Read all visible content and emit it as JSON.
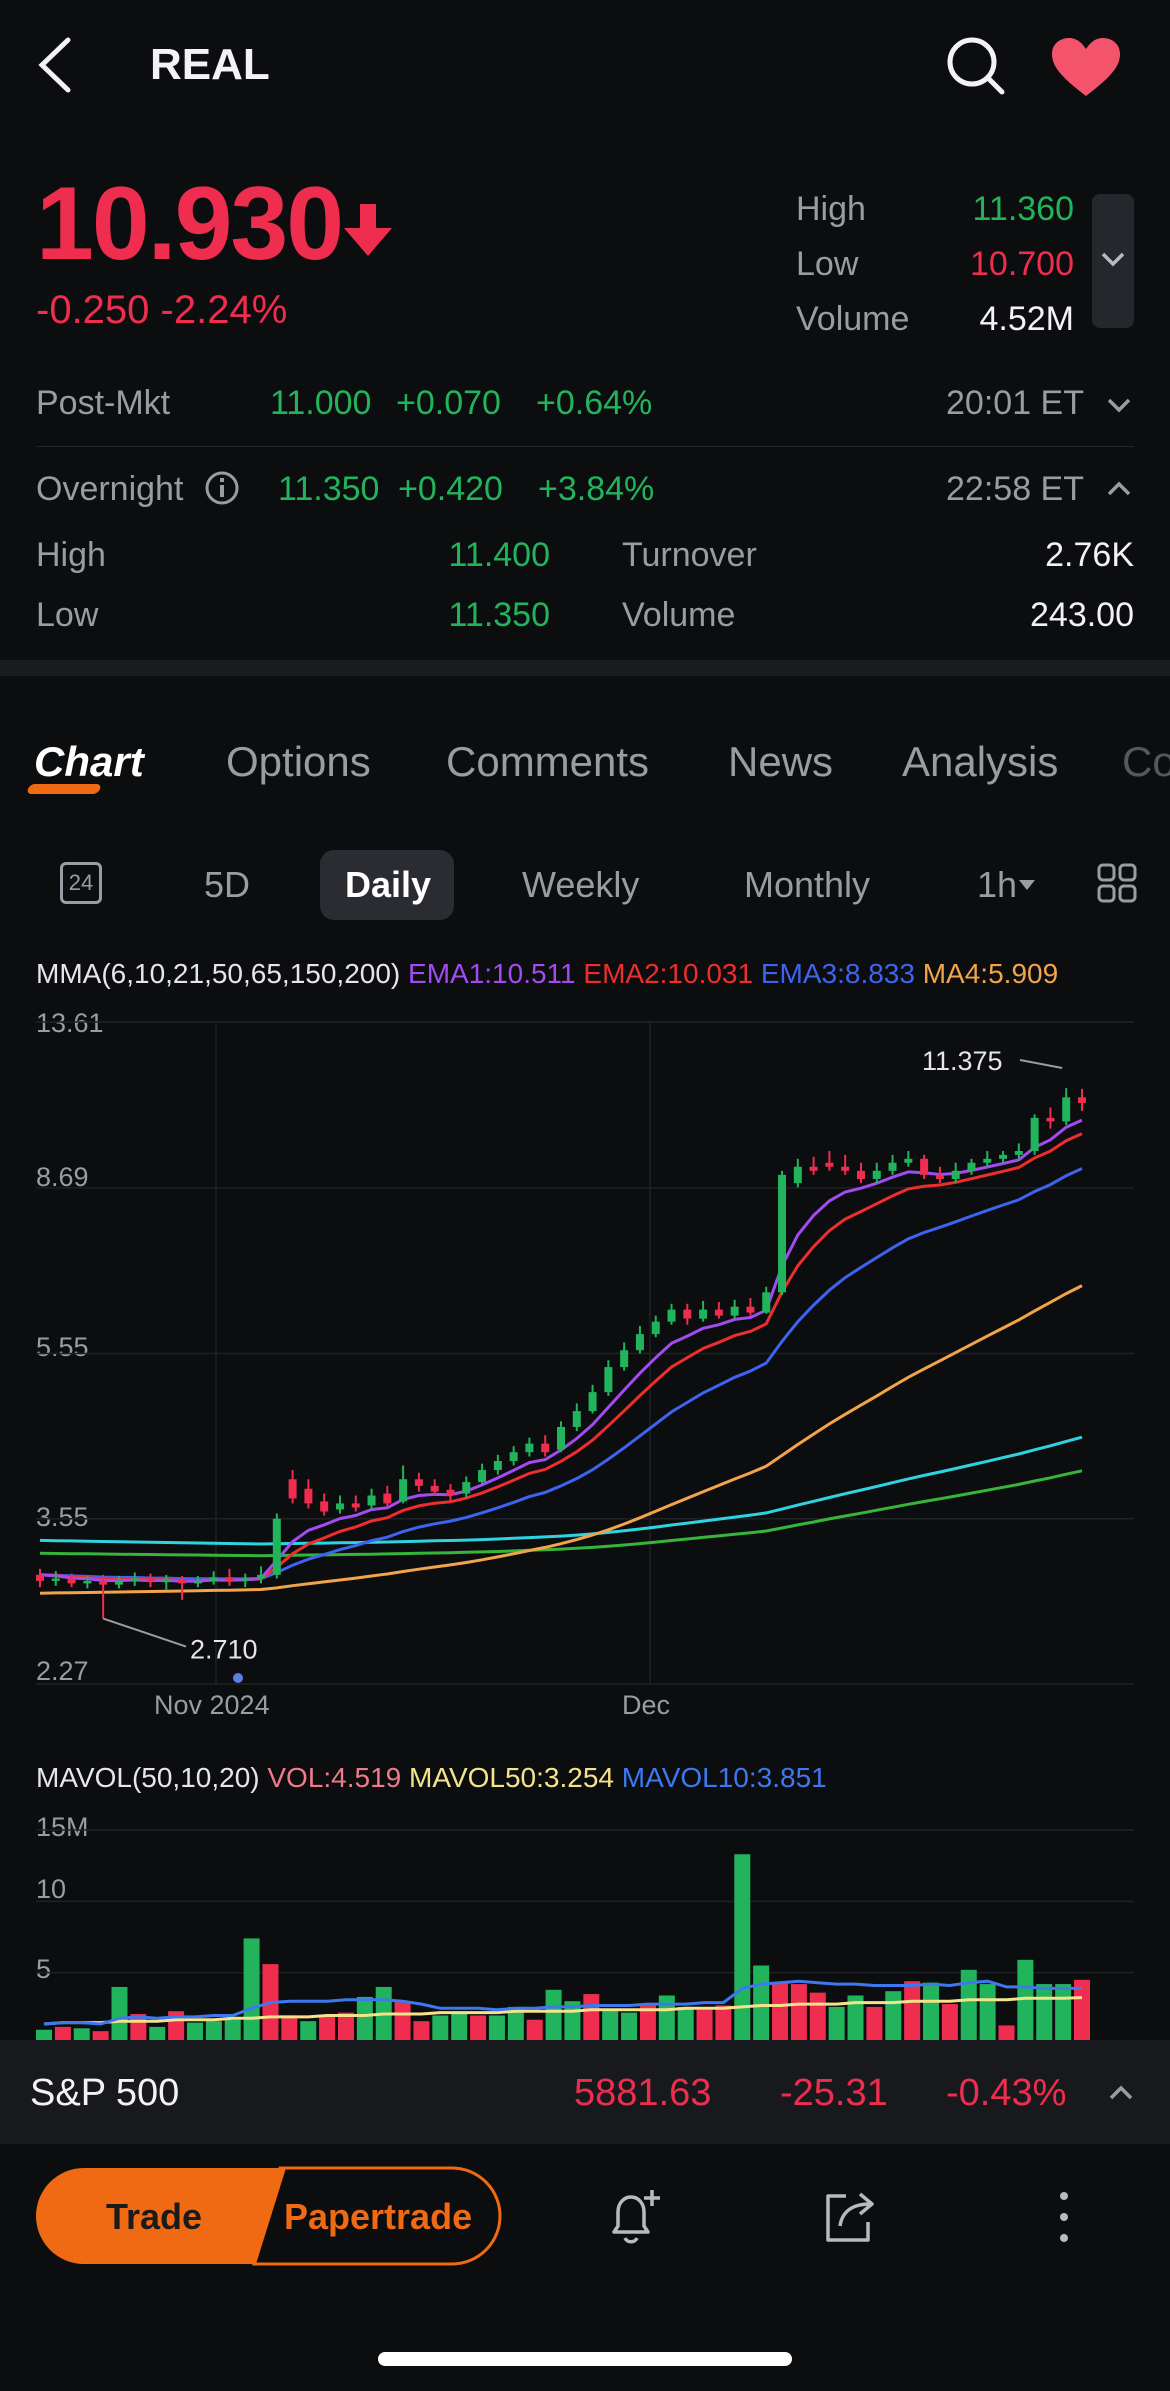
{
  "header": {
    "title": "REAL"
  },
  "quote": {
    "price": "10.930",
    "change": "-0.250",
    "change_pct": "-2.24%",
    "high_label": "High",
    "high": "11.360",
    "low_label": "Low",
    "low": "10.700",
    "volume_label": "Volume",
    "volume": "4.52M"
  },
  "post_market": {
    "label": "Post-Mkt",
    "price": "11.000",
    "change": "+0.070",
    "pct": "+0.64%",
    "time": "20:01 ET"
  },
  "overnight": {
    "label": "Overnight",
    "price": "11.350",
    "change": "+0.420",
    "pct": "+3.84%",
    "time": "22:58 ET",
    "high_label": "High",
    "high": "11.400",
    "low_label": "Low",
    "low": "11.350",
    "turnover_label": "Turnover",
    "turnover": "2.76K",
    "volume_label": "Volume",
    "volume": "243.00"
  },
  "tabs": [
    "Chart",
    "Options",
    "Comments",
    "News",
    "Analysis",
    "Co"
  ],
  "periods": {
    "badge": "24",
    "items": [
      "5D",
      "Daily",
      "Weekly",
      "Monthly",
      "1h"
    ]
  },
  "legend": {
    "mma": "MMA(6,10,21,50,65,150,200)",
    "ema1": "EMA1:10.511",
    "ema2": "EMA2:10.031",
    "ema3": "EMA3:8.833",
    "ma4": "MA4:5.909"
  },
  "vol_legend": {
    "mavol": "MAVOL(50,10,20)",
    "vol": "VOL:4.519",
    "mavol50": "MAVOL50:3.254",
    "mavol10": "MAVOL10:3.851"
  },
  "colors": {
    "up": "#22b45c",
    "down": "#ee2d4f",
    "ema1": "#a24bf0",
    "ema2": "#ee2d2d",
    "ema3": "#3d64f0",
    "ma4": "#f2a44a",
    "ma5": "#2fd3e0",
    "ma6": "#36b53a",
    "mavol50": "#f5e38a",
    "mavol10": "#3d78f0",
    "accent": "#ef6a12"
  },
  "chart_data": [
    {
      "type": "candlestick",
      "y_ticks": [
        "13.61",
        "8.69",
        "5.55",
        "3.55",
        "2.27"
      ],
      "x_ticks": [
        "Nov 2024",
        "Dec"
      ],
      "annotations": {
        "high": "11.375",
        "low": "2.710"
      },
      "candles": [
        [
          3.05,
          3.0,
          3.1,
          2.95
        ],
        [
          3.0,
          3.02,
          3.08,
          2.96
        ],
        [
          3.02,
          2.98,
          3.06,
          2.95
        ],
        [
          2.98,
          3.0,
          3.04,
          2.94
        ],
        [
          3.0,
          2.97,
          3.05,
          2.71
        ],
        [
          2.97,
          3.0,
          3.04,
          2.94
        ],
        [
          3.0,
          3.02,
          3.07,
          2.96
        ],
        [
          3.02,
          2.99,
          3.06,
          2.95
        ],
        [
          2.99,
          3.01,
          3.05,
          2.93
        ],
        [
          3.01,
          2.98,
          3.04,
          2.85
        ],
        [
          2.98,
          3.0,
          3.04,
          2.95
        ],
        [
          3.0,
          3.03,
          3.08,
          2.97
        ],
        [
          3.03,
          3.0,
          3.1,
          2.96
        ],
        [
          3.0,
          3.02,
          3.06,
          2.95
        ],
        [
          3.02,
          3.05,
          3.12,
          2.98
        ],
        [
          3.05,
          3.55,
          3.6,
          3.02
        ],
        [
          3.95,
          3.75,
          4.05,
          3.7
        ],
        [
          3.85,
          3.7,
          3.95,
          3.65
        ],
        [
          3.72,
          3.62,
          3.8,
          3.58
        ],
        [
          3.64,
          3.7,
          3.78,
          3.6
        ],
        [
          3.7,
          3.66,
          3.78,
          3.62
        ],
        [
          3.68,
          3.78,
          3.85,
          3.64
        ],
        [
          3.8,
          3.7,
          3.88,
          3.66
        ],
        [
          3.72,
          3.95,
          4.1,
          3.7
        ],
        [
          3.95,
          3.88,
          4.02,
          3.82
        ],
        [
          3.88,
          3.82,
          3.95,
          3.78
        ],
        [
          3.84,
          3.78,
          3.9,
          3.72
        ],
        [
          3.8,
          3.92,
          3.98,
          3.76
        ],
        [
          3.92,
          4.05,
          4.12,
          3.9
        ],
        [
          4.05,
          4.15,
          4.22,
          4.0
        ],
        [
          4.15,
          4.25,
          4.32,
          4.1
        ],
        [
          4.25,
          4.35,
          4.42,
          4.2
        ],
        [
          4.35,
          4.25,
          4.45,
          4.2
        ],
        [
          4.28,
          4.55,
          4.62,
          4.25
        ],
        [
          4.55,
          4.75,
          4.85,
          4.5
        ],
        [
          4.75,
          5.0,
          5.1,
          4.72
        ],
        [
          5.0,
          5.35,
          5.45,
          4.95
        ],
        [
          5.35,
          5.6,
          5.72,
          5.3
        ],
        [
          5.6,
          5.85,
          5.98,
          5.55
        ],
        [
          5.85,
          6.05,
          6.15,
          5.8
        ],
        [
          6.05,
          6.25,
          6.35,
          6.0
        ],
        [
          6.25,
          6.1,
          6.35,
          6.0
        ],
        [
          6.1,
          6.25,
          6.4,
          6.05
        ],
        [
          6.25,
          6.15,
          6.38,
          6.1
        ],
        [
          6.15,
          6.3,
          6.42,
          6.1
        ],
        [
          6.3,
          6.2,
          6.45,
          6.15
        ],
        [
          6.2,
          6.55,
          6.65,
          6.18
        ],
        [
          6.55,
          9.0,
          9.1,
          6.5
        ],
        [
          8.8,
          9.2,
          9.4,
          8.7
        ],
        [
          9.2,
          9.1,
          9.45,
          9.0
        ],
        [
          9.3,
          9.2,
          9.6,
          9.1
        ],
        [
          9.2,
          9.1,
          9.5,
          9.0
        ],
        [
          9.1,
          8.9,
          9.3,
          8.8
        ],
        [
          8.9,
          9.1,
          9.3,
          8.8
        ],
        [
          9.1,
          9.3,
          9.5,
          9.0
        ],
        [
          9.3,
          9.4,
          9.6,
          9.2
        ],
        [
          9.4,
          9.0,
          9.5,
          8.9
        ],
        [
          9.0,
          8.9,
          9.2,
          8.8
        ],
        [
          8.9,
          9.1,
          9.3,
          8.8
        ],
        [
          9.1,
          9.3,
          9.4,
          9.0
        ],
        [
          9.3,
          9.4,
          9.6,
          9.2
        ],
        [
          9.4,
          9.5,
          9.6,
          9.3
        ],
        [
          9.5,
          9.6,
          9.8,
          9.4
        ],
        [
          9.6,
          10.5,
          10.6,
          9.5
        ],
        [
          10.5,
          10.4,
          10.8,
          10.2
        ],
        [
          10.4,
          11.1,
          11.38,
          10.3
        ],
        [
          11.1,
          10.93,
          11.36,
          10.7
        ]
      ]
    },
    {
      "type": "bar",
      "y_ticks": [
        "15M",
        "10",
        "5"
      ],
      "values": [
        1.0,
        1.2,
        1.1,
        0.9,
        4.0,
        2.1,
        1.2,
        2.3,
        1.5,
        1.6,
        1.7,
        7.4,
        5.6,
        2.0,
        1.6,
        2.0,
        2.2,
        3.3,
        4.0,
        3.0,
        1.6,
        2.0,
        2.2,
        2.0,
        2.0,
        2.6,
        1.7,
        3.8,
        3.0,
        3.5,
        2.3,
        2.2,
        2.7,
        3.4,
        2.6,
        2.4,
        2.7,
        13.3,
        5.5,
        4.3,
        4.2,
        3.6,
        2.6,
        3.4,
        2.6,
        3.7,
        4.4,
        4.3,
        2.8,
        5.2,
        4.2,
        1.3,
        5.9,
        4.2,
        4.2,
        4.5
      ],
      "ups": [
        1,
        0,
        1,
        0,
        1,
        0,
        1,
        0,
        1,
        1,
        1,
        1,
        0,
        0,
        1,
        0,
        0,
        1,
        1,
        0,
        0,
        1,
        1,
        0,
        1,
        1,
        0,
        1,
        1,
        0,
        1,
        1,
        0,
        1,
        1,
        0,
        0,
        1,
        1,
        0,
        0,
        0,
        1,
        1,
        0,
        1,
        0,
        1,
        0,
        1,
        1,
        0,
        1,
        1,
        1,
        0
      ],
      "mavol10": [
        1.4,
        1.5,
        1.5,
        1.4,
        1.8,
        1.9,
        1.8,
        1.9,
        1.9,
        2.0,
        2.0,
        2.5,
        2.9,
        3.0,
        3.0,
        3.0,
        3.1,
        3.1,
        3.1,
        3.0,
        2.8,
        2.5,
        2.5,
        2.5,
        2.4,
        2.5,
        2.5,
        2.6,
        2.6,
        2.7,
        2.7,
        2.7,
        2.8,
        2.8,
        2.8,
        2.9,
        2.9,
        3.9,
        4.2,
        4.3,
        4.4,
        4.3,
        4.2,
        4.2,
        4.1,
        4.1,
        4.1,
        4.2,
        4.1,
        4.3,
        4.4,
        4.0,
        4.0,
        3.9,
        3.9,
        3.9
      ],
      "mavol50": [
        1.4,
        1.5,
        1.5,
        1.5,
        1.6,
        1.6,
        1.6,
        1.7,
        1.7,
        1.7,
        1.8,
        1.8,
        1.9,
        1.9,
        1.9,
        2.0,
        2.0,
        2.0,
        2.1,
        2.1,
        2.1,
        2.2,
        2.2,
        2.2,
        2.2,
        2.3,
        2.3,
        2.3,
        2.3,
        2.4,
        2.4,
        2.4,
        2.4,
        2.4,
        2.5,
        2.5,
        2.5,
        2.6,
        2.7,
        2.7,
        2.8,
        2.8,
        2.8,
        2.9,
        2.9,
        2.9,
        3.0,
        3.0,
        3.0,
        3.1,
        3.1,
        3.1,
        3.2,
        3.2,
        3.2,
        3.25
      ]
    }
  ],
  "index_bar": {
    "name": "S&P 500",
    "price": "5881.63",
    "change": "-25.31",
    "pct": "-0.43%"
  },
  "actions": {
    "trade": "Trade",
    "papertrade": "Papertrade"
  }
}
